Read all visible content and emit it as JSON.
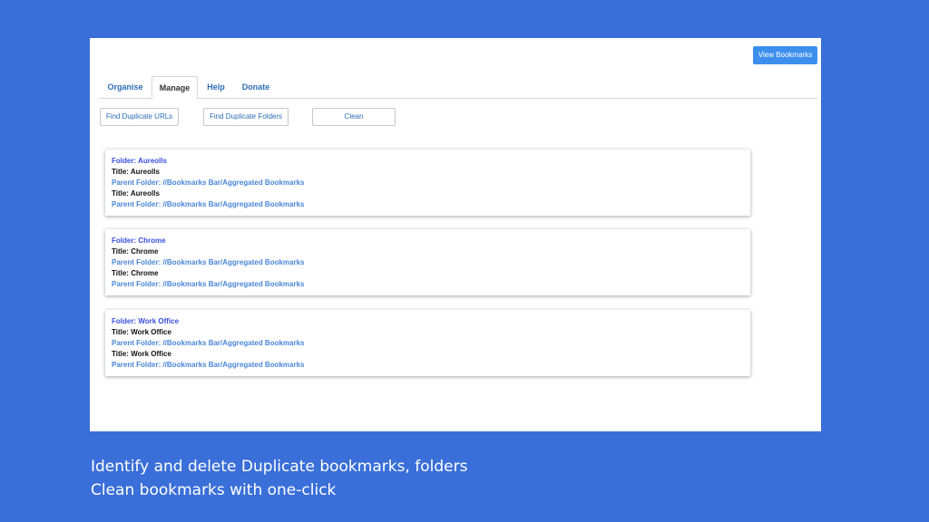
{
  "toolbar": {
    "view_bookmarks_label": "View Bookmarks"
  },
  "tabs": [
    {
      "label": "Organise",
      "active": false
    },
    {
      "label": "Manage",
      "active": true
    },
    {
      "label": "Help",
      "active": false
    },
    {
      "label": "Donate",
      "active": false
    }
  ],
  "actions": {
    "find_duplicate_urls": "Find Duplicate URLs",
    "find_duplicate_folders": "Find Duplicate Folders",
    "clean": "Clean"
  },
  "results": [
    {
      "folder": "Folder: Aureolls",
      "entries": [
        {
          "title": "Title: Aureolls",
          "parent": "Parent Folder: //Bookmarks Bar/Aggregated Bookmarks"
        },
        {
          "title": "Title: Aureolls",
          "parent": "Parent Folder: //Bookmarks Bar/Aggregated Bookmarks"
        }
      ]
    },
    {
      "folder": "Folder: Chrome",
      "entries": [
        {
          "title": "Title: Chrome",
          "parent": "Parent Folder: //Bookmarks Bar/Aggregated Bookmarks"
        },
        {
          "title": "Title: Chrome",
          "parent": "Parent Folder: //Bookmarks Bar/Aggregated Bookmarks"
        }
      ]
    },
    {
      "folder": "Folder: Work Office",
      "entries": [
        {
          "title": "Title: Work Office",
          "parent": "Parent Folder: //Bookmarks Bar/Aggregated Bookmarks"
        },
        {
          "title": "Title: Work Office",
          "parent": "Parent Folder: //Bookmarks Bar/Aggregated Bookmarks"
        }
      ]
    }
  ],
  "caption": {
    "line1": "Identify and delete Duplicate bookmarks, folders",
    "line2": "Clean bookmarks with one-click"
  },
  "colors": {
    "background": "#3a6fd9",
    "accent_button": "#3d8fee",
    "link": "#2b6db7",
    "folder_text": "#3a4fe0",
    "parent_text": "#4a86d8"
  }
}
